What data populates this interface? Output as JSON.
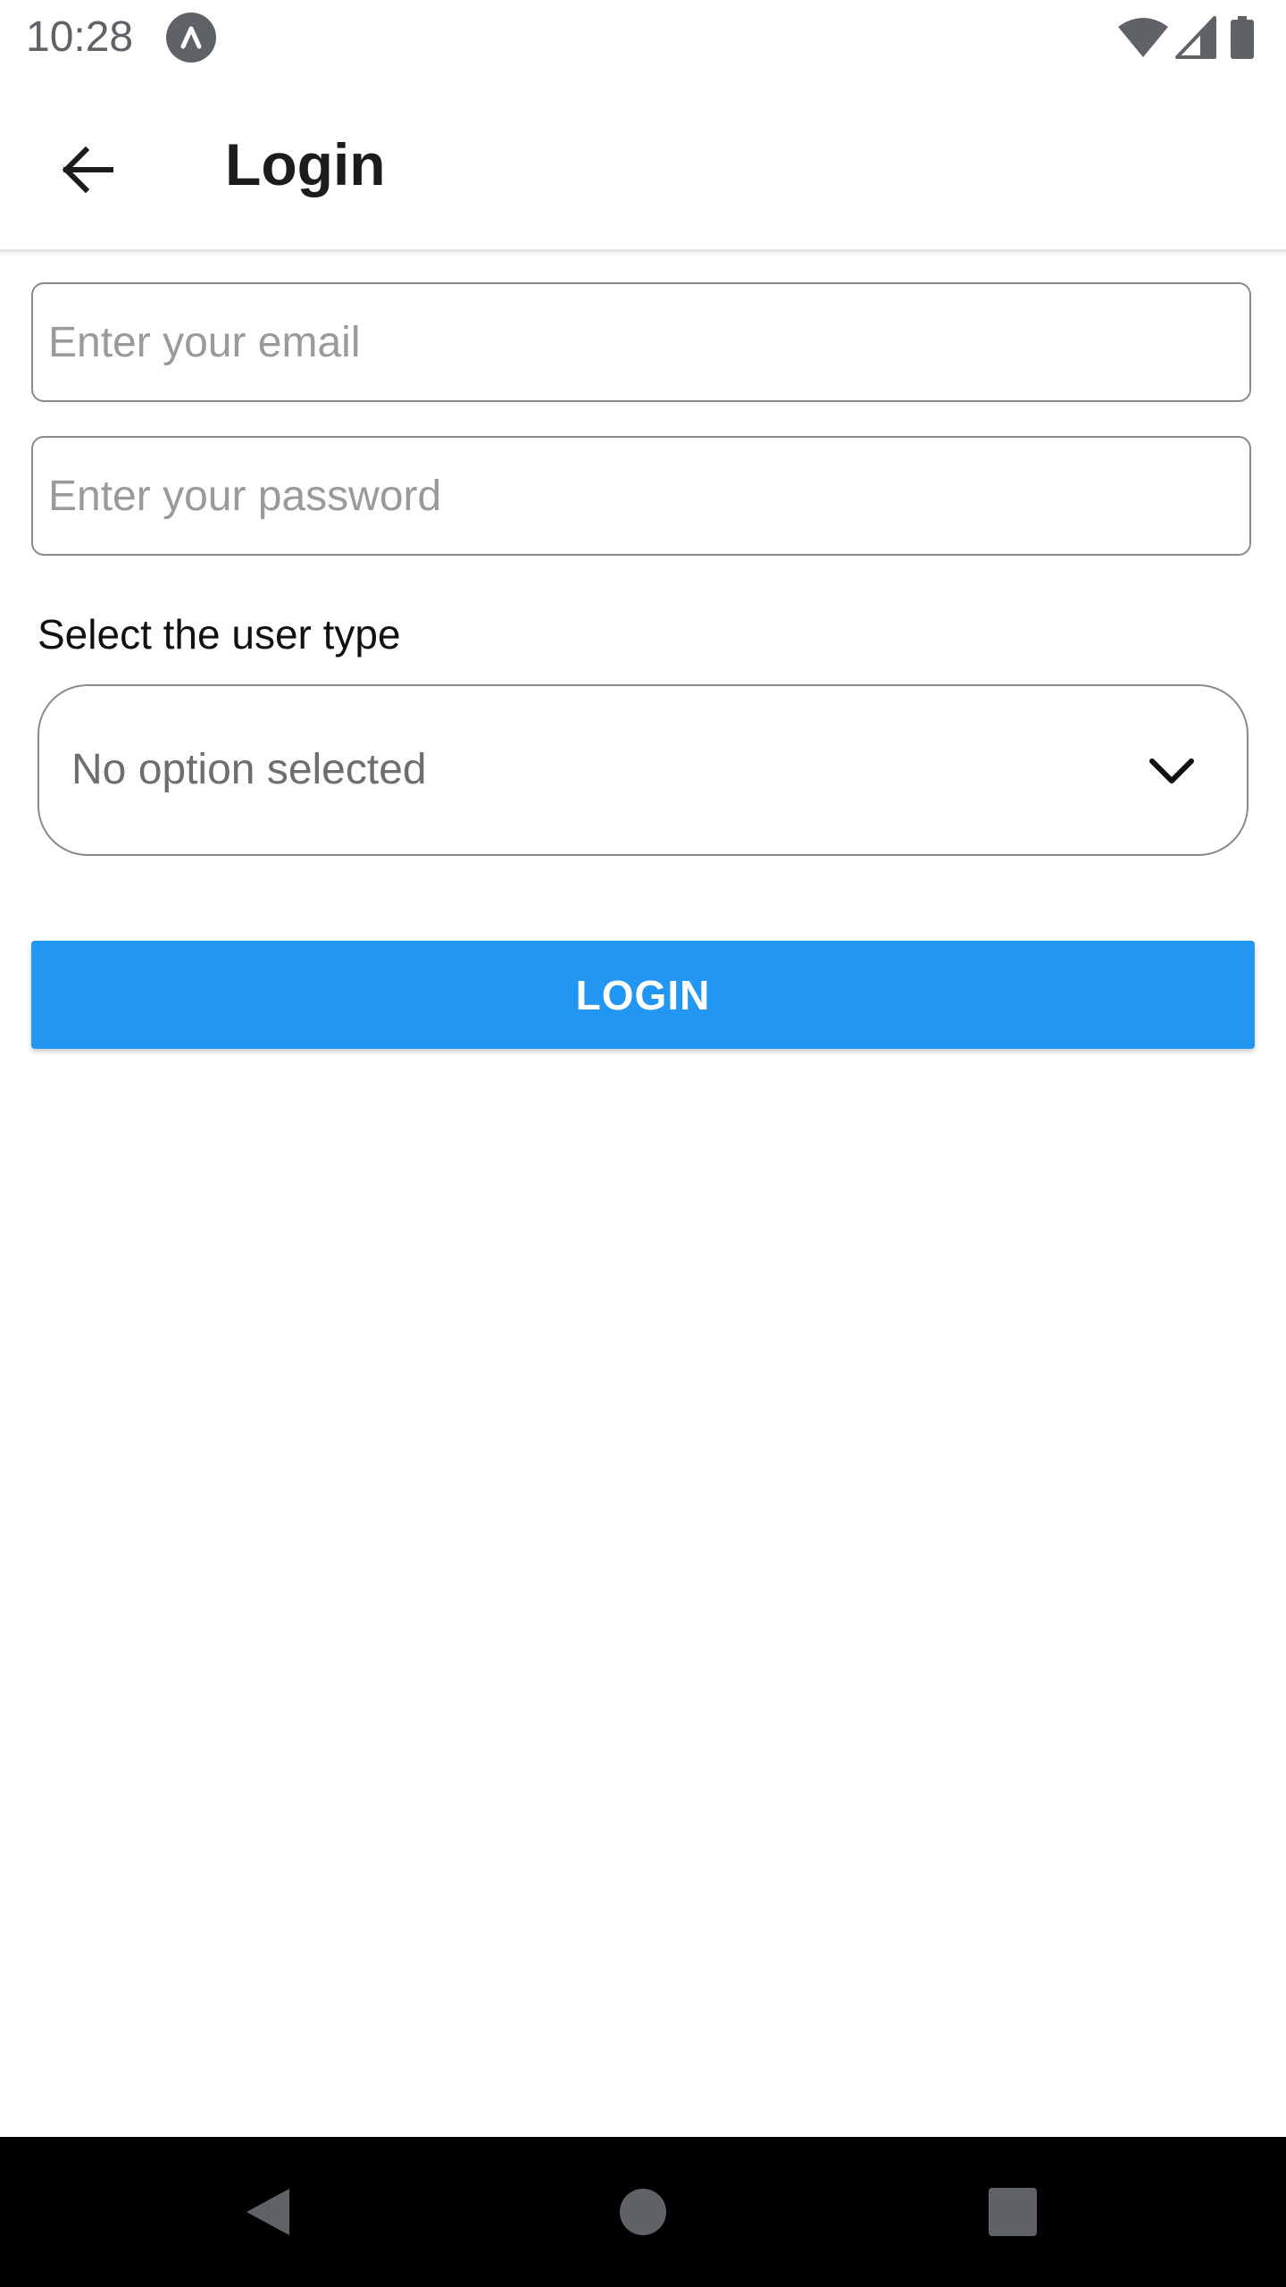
{
  "status_bar": {
    "time": "10:28",
    "icons": [
      "app-notification-icon",
      "wifi-icon",
      "signal-icon",
      "battery-icon"
    ]
  },
  "app_bar": {
    "title": "Login",
    "back_icon": "arrow-left-icon"
  },
  "form": {
    "email": {
      "value": "",
      "placeholder": "Enter your email"
    },
    "password": {
      "value": "",
      "placeholder": "Enter your password"
    },
    "user_type": {
      "label": "Select the user type",
      "selected": "No option selected",
      "icon": "chevron-down-icon"
    },
    "login_label": "LOGIN"
  },
  "colors": {
    "primary": "#2196f3",
    "nav_bar": "#000000"
  },
  "nav_bar": {
    "icons": [
      "nav-back-icon",
      "nav-home-icon",
      "nav-recents-icon"
    ]
  }
}
